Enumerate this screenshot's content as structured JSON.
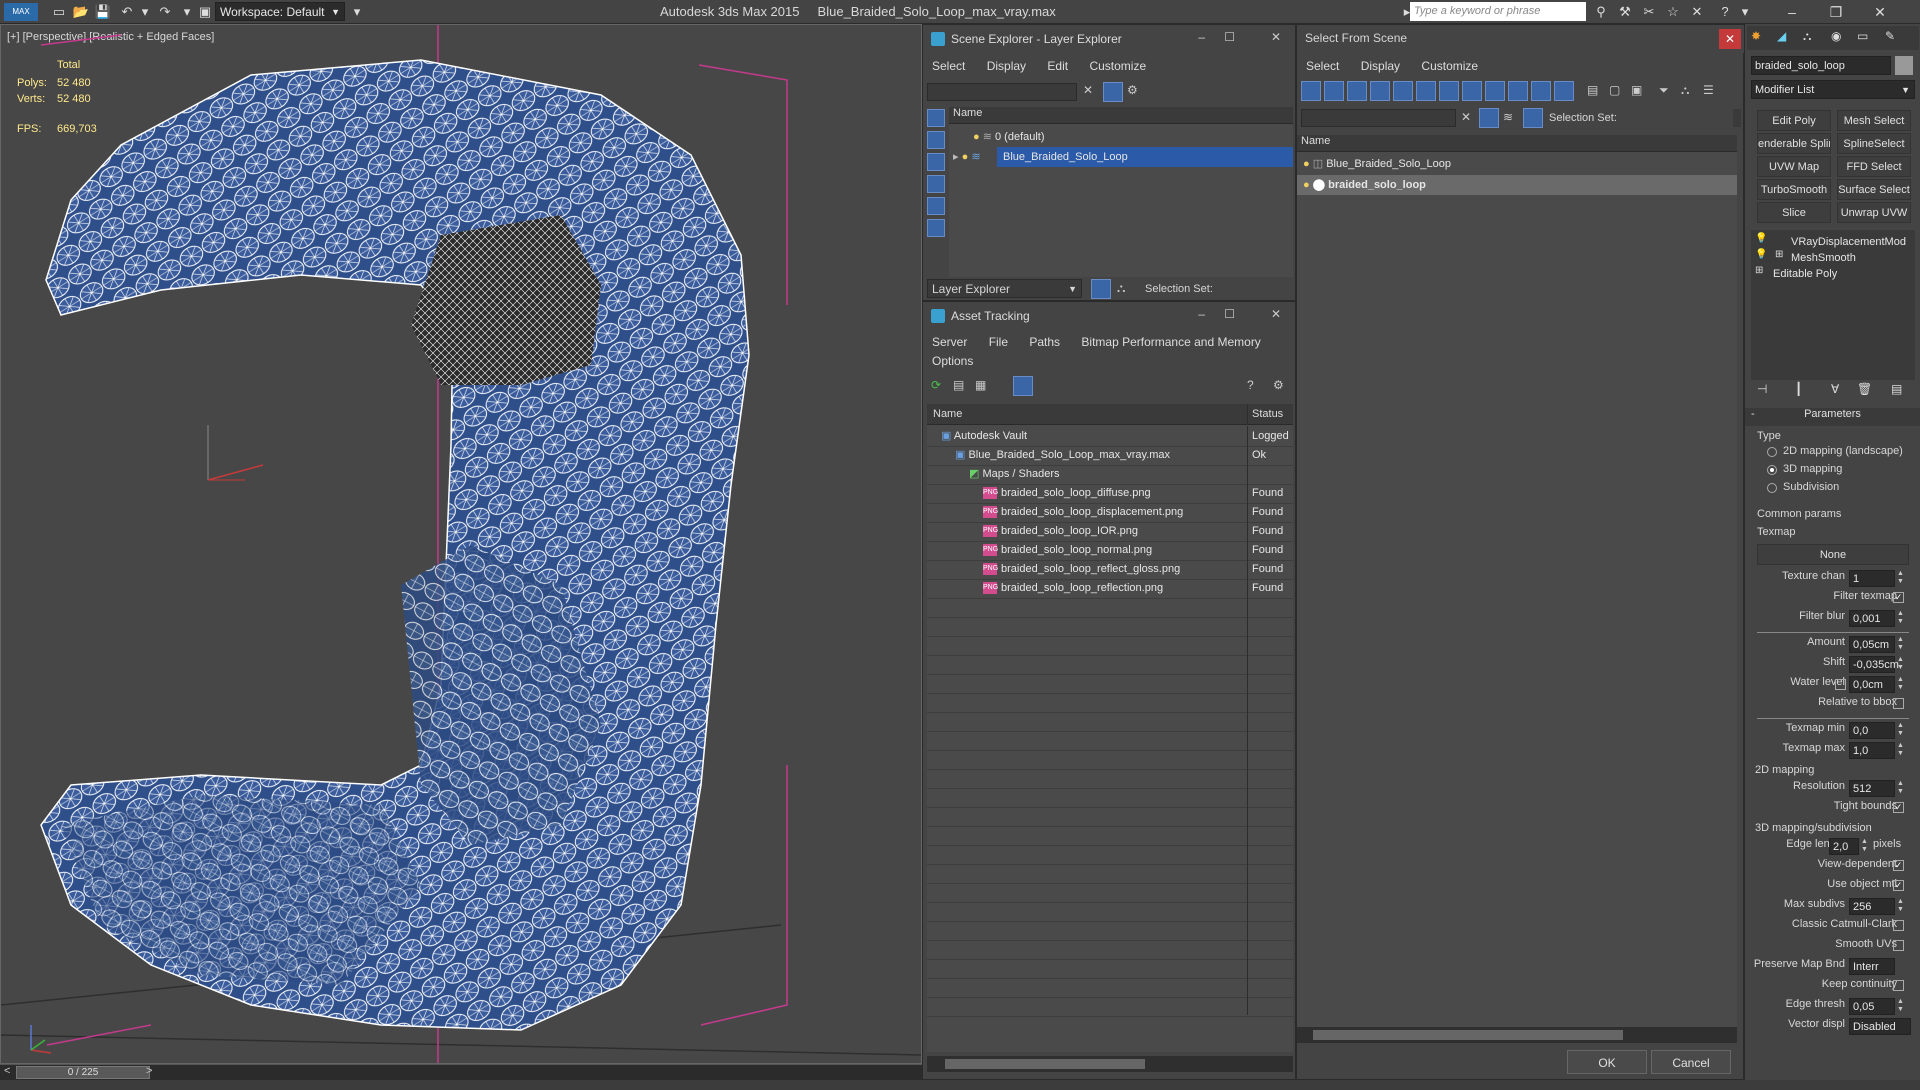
{
  "app": {
    "logo": "MAX",
    "workspace": "Workspace: Default",
    "title": "Autodesk 3ds Max  2015",
    "filename": "Blue_Braided_Solo_Loop_max_vray.max",
    "search_placeholder": "Type a keyword or phrase"
  },
  "viewport": {
    "label": "[+] [Perspective] [Realistic + Edged Faces]",
    "stats": {
      "total_label": "Total",
      "polys_label": "Polys:",
      "polys": "52 480",
      "verts_label": "Verts:",
      "verts": "52 480",
      "fps_label": "FPS:",
      "fps": "669,703"
    },
    "timeline": "0 / 225",
    "mesh_color": "#2f4f8a",
    "wire_color": "#ffffff"
  },
  "scene_explorer": {
    "title": "Scene Explorer - Layer Explorer",
    "menu": [
      "Select",
      "Display",
      "Edit",
      "Customize"
    ],
    "column": "Name",
    "rows": [
      {
        "label": "0 (default)",
        "selected": false
      },
      {
        "label": "Blue_Braided_Solo_Loop",
        "selected": true
      }
    ],
    "footer_dropdown": "Layer Explorer",
    "selection_set": "Selection Set:"
  },
  "asset_tracking": {
    "title": "Asset Tracking",
    "menu": [
      "Server",
      "File",
      "Paths",
      "Bitmap Performance and Memory"
    ],
    "menu2": [
      "Options"
    ],
    "col_name": "Name",
    "col_status": "Status",
    "rows": [
      {
        "name": "Autodesk Vault",
        "status": "Logged",
        "indent": 1,
        "icon": "vault-icon"
      },
      {
        "name": "Blue_Braided_Solo_Loop_max_vray.max",
        "status": "Ok",
        "indent": 2,
        "icon": "max-file-icon"
      },
      {
        "name": "Maps / Shaders",
        "status": "",
        "indent": 3,
        "icon": "maps-icon"
      },
      {
        "name": "braided_solo_loop_diffuse.png",
        "status": "Found",
        "indent": 4,
        "icon": "png-icon"
      },
      {
        "name": "braided_solo_loop_displacement.png",
        "status": "Found",
        "indent": 4,
        "icon": "png-icon"
      },
      {
        "name": "braided_solo_loop_IOR.png",
        "status": "Found",
        "indent": 4,
        "icon": "png-icon"
      },
      {
        "name": "braided_solo_loop_normal.png",
        "status": "Found",
        "indent": 4,
        "icon": "png-icon"
      },
      {
        "name": "braided_solo_loop_reflect_gloss.png",
        "status": "Found",
        "indent": 4,
        "icon": "png-icon"
      },
      {
        "name": "braided_solo_loop_reflection.png",
        "status": "Found",
        "indent": 4,
        "icon": "png-icon"
      }
    ]
  },
  "select_from_scene": {
    "title": "Select From Scene",
    "menu": [
      "Select",
      "Display",
      "Customize"
    ],
    "selection_set": "Selection Set:",
    "column": "Name",
    "rows": [
      {
        "label": "Blue_Braided_Solo_Loop",
        "selected": false
      },
      {
        "label": "braided_solo_loop",
        "selected": true
      }
    ],
    "ok": "OK",
    "cancel": "Cancel"
  },
  "command_panel": {
    "object_name": "braided_solo_loop",
    "modifier_list": "Modifier List",
    "mod_buttons": [
      "Edit Poly",
      "Mesh Select",
      "enderable Splir",
      "SplineSelect",
      "UVW Map",
      "FFD Select",
      "TurboSmooth",
      "Surface Select",
      "Slice",
      "Unwrap UVW"
    ],
    "stack": [
      "VRayDisplacementMod",
      "MeshSmooth",
      "Editable Poly"
    ],
    "params_title": "Parameters",
    "type_label": "Type",
    "type_options": [
      "2D mapping (landscape)",
      "3D mapping",
      "Subdivision"
    ],
    "type_selected": "3D mapping",
    "common_params": "Common params",
    "texmap_label": "Texmap",
    "texmap_value": "None",
    "fields": {
      "texture_chan_label": "Texture chan",
      "texture_chan": "1",
      "filter_texmap_label": "Filter texmap",
      "filter_blur_label": "Filter blur",
      "filter_blur": "0,001",
      "amount_label": "Amount",
      "amount": "0,05cm",
      "shift_label": "Shift",
      "shift": "-0,035cm",
      "water_level_label": "Water level",
      "water_level": "0,0cm",
      "relative_bbox_label": "Relative to bbox",
      "texmap_min_label": "Texmap min",
      "texmap_min": "0,0",
      "texmap_max_label": "Texmap max",
      "texmap_max": "1,0"
    },
    "mapping2d": "2D mapping",
    "resolution_label": "Resolution",
    "resolution": "512",
    "tight_bounds_label": "Tight bounds",
    "mapping3d": "3D mapping/subdivision",
    "edge_length_label": "Edge length",
    "edge_length": "2,0",
    "pixels": "pixels",
    "view_dependent_label": "View-dependent",
    "use_object_mtl_label": "Use object mtl",
    "max_subdivs_label": "Max subdivs",
    "max_subdivs": "256",
    "classic_catmull_label": "Classic Catmull-Clark",
    "smooth_uvs_label": "Smooth UVs",
    "preserve_map_label": "Preserve Map Bnd",
    "preserve_map": "Interr",
    "keep_continuity_label": "Keep continuity",
    "edge_thresh_label": "Edge thresh",
    "edge_thresh": "0,05",
    "vector_displ_label": "Vector displ",
    "vector_displ": "Disabled"
  }
}
